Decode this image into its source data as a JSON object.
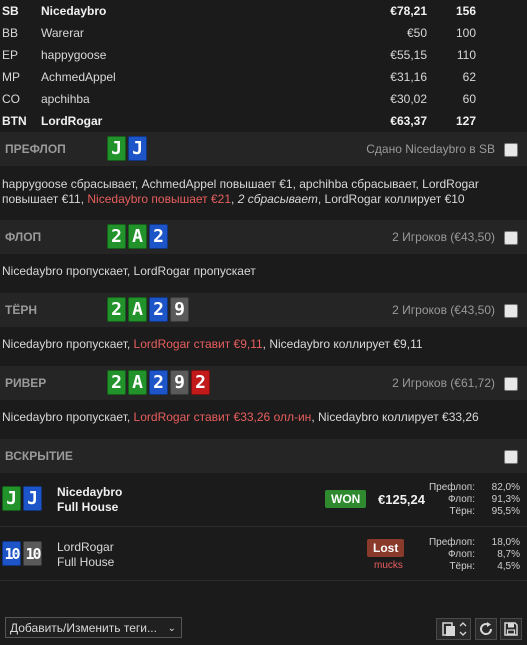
{
  "players": [
    {
      "pos": "SB",
      "name": "Nicedaybro",
      "stack": "€78,21",
      "bb": "156",
      "bold": true
    },
    {
      "pos": "BB",
      "name": "Warerar",
      "stack": "€50",
      "bb": "100",
      "bold": false
    },
    {
      "pos": "EP",
      "name": "happygoose",
      "stack": "€55,15",
      "bb": "110",
      "bold": false
    },
    {
      "pos": "MP",
      "name": "AchmedAppel",
      "stack": "€31,16",
      "bb": "62",
      "bold": false
    },
    {
      "pos": "CO",
      "name": "apchihba",
      "stack": "€30,02",
      "bb": "60",
      "bold": false
    },
    {
      "pos": "BTN",
      "name": "LordRogar",
      "stack": "€63,37",
      "bb": "127",
      "bold": true
    }
  ],
  "preflop": {
    "title": "ПРЕФЛОП",
    "cards": [
      {
        "rank": "J",
        "suit": "club"
      },
      {
        "rank": "J",
        "suit": "diamond"
      }
    ],
    "summary": "Сдано Nicedaybro в SB",
    "action_1": "happygoose сбрасывает, AchmedAppel повышает €1, apchihba сбрасывает, LordRogar",
    "action_2a": "повышает €11, ",
    "action_2b": "Nicedaybro повышает €21",
    "action_2c": ", ",
    "action_2d": "2 сбрасывает",
    "action_2e": ", LordRogar коллирует €10"
  },
  "flop": {
    "title": "ФЛОП",
    "cards": [
      {
        "rank": "2",
        "suit": "club"
      },
      {
        "rank": "A",
        "suit": "club"
      },
      {
        "rank": "2",
        "suit": "diamond"
      }
    ],
    "summary": "2 Игроков (€43,50)",
    "action": "Nicedaybro пропускает, LordRogar пропускает"
  },
  "turn": {
    "title": "ТЁРН",
    "cards": [
      {
        "rank": "2",
        "suit": "club"
      },
      {
        "rank": "A",
        "suit": "club"
      },
      {
        "rank": "2",
        "suit": "diamond"
      },
      {
        "rank": "9",
        "suit": "spade"
      }
    ],
    "summary": "2 Игроков (€43,50)",
    "action_a": "Nicedaybro пропускает, ",
    "action_b": "LordRogar ставит €9,11",
    "action_c": ", Nicedaybro коллирует €9,11"
  },
  "river": {
    "title": "РИВЕР",
    "cards": [
      {
        "rank": "2",
        "suit": "club"
      },
      {
        "rank": "A",
        "suit": "club"
      },
      {
        "rank": "2",
        "suit": "diamond"
      },
      {
        "rank": "9",
        "suit": "spade"
      },
      {
        "rank": "2",
        "suit": "heart"
      }
    ],
    "summary": "2 Игроков (€61,72)",
    "action_a": "Nicedaybro пропускает, ",
    "action_b": "LordRogar ставит €33,26 олл-ин",
    "action_c": ", Nicedaybro коллирует €33,26"
  },
  "showdown": {
    "title": "ВСКРЫТИЕ",
    "p1": {
      "cards": [
        {
          "rank": "J",
          "suit": "club"
        },
        {
          "rank": "J",
          "suit": "diamond"
        }
      ],
      "name": "Nicedaybro",
      "hand": "Full House",
      "badge": "WON",
      "amount": "€125,24",
      "eq_labels": [
        "Префлоп:",
        "Флоп:",
        "Тёрн:"
      ],
      "eq_values": [
        "82,0%",
        "91,3%",
        "95,5%"
      ]
    },
    "p2": {
      "cards": [
        {
          "rank": "10",
          "suit": "diamond"
        },
        {
          "rank": "10",
          "suit": "spade"
        }
      ],
      "name": "LordRogar",
      "hand": "Full House",
      "badge": "Lost",
      "status": "mucks",
      "eq_labels": [
        "Префлоп:",
        "Флоп:",
        "Тёрн:"
      ],
      "eq_values": [
        "18,0%",
        "8,7%",
        "4,5%"
      ]
    }
  },
  "footer": {
    "tags_label": "Добавить/Изменить теги...",
    "icons": [
      "copy-icon",
      "refresh-icon",
      "save-icon"
    ]
  },
  "colors": {
    "club": "#22922a",
    "diamond": "#1d55c8",
    "spade": "#5a5a5a",
    "heart": "#c21a1a",
    "won": "#2f8a2f",
    "lost": "#8a3a2a",
    "highlight": "#e85e5e"
  }
}
